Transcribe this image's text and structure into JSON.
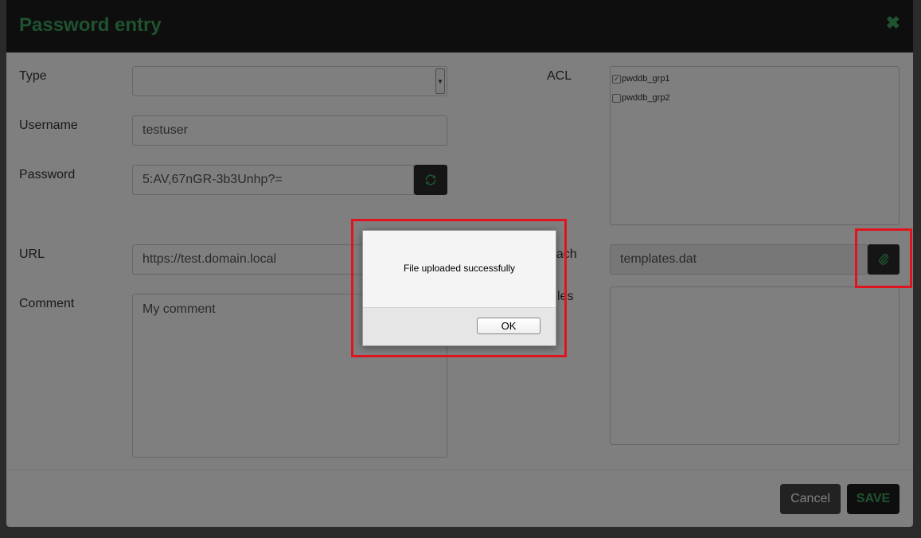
{
  "modal": {
    "title": "Password entry",
    "close_symbol": "✖"
  },
  "form": {
    "type": {
      "label": "Type",
      "value": ""
    },
    "username": {
      "label": "Username",
      "value": "testuser"
    },
    "password": {
      "label": "Password",
      "value": "5:AV,67nGR-3b3Unhp?="
    },
    "url": {
      "label": "URL",
      "value": "https://test.domain.local"
    },
    "comment": {
      "label": "Comment",
      "value": "My comment"
    },
    "acl": {
      "label": "ACL",
      "items": [
        {
          "label": "pwddb_grp1",
          "checked": true
        },
        {
          "label": "pwddb_grp2",
          "checked": false
        }
      ]
    },
    "attach": {
      "label_visible": "ttach",
      "value": "templates.dat"
    },
    "files": {
      "label_visible": "les"
    }
  },
  "footer": {
    "cancel_label": "Cancel",
    "save_label": "SAVE"
  },
  "alert": {
    "message": "File uploaded successfully",
    "ok_label": "OK"
  },
  "colors": {
    "accent_green": "#3fa660",
    "highlight_red": "#e0141e"
  }
}
